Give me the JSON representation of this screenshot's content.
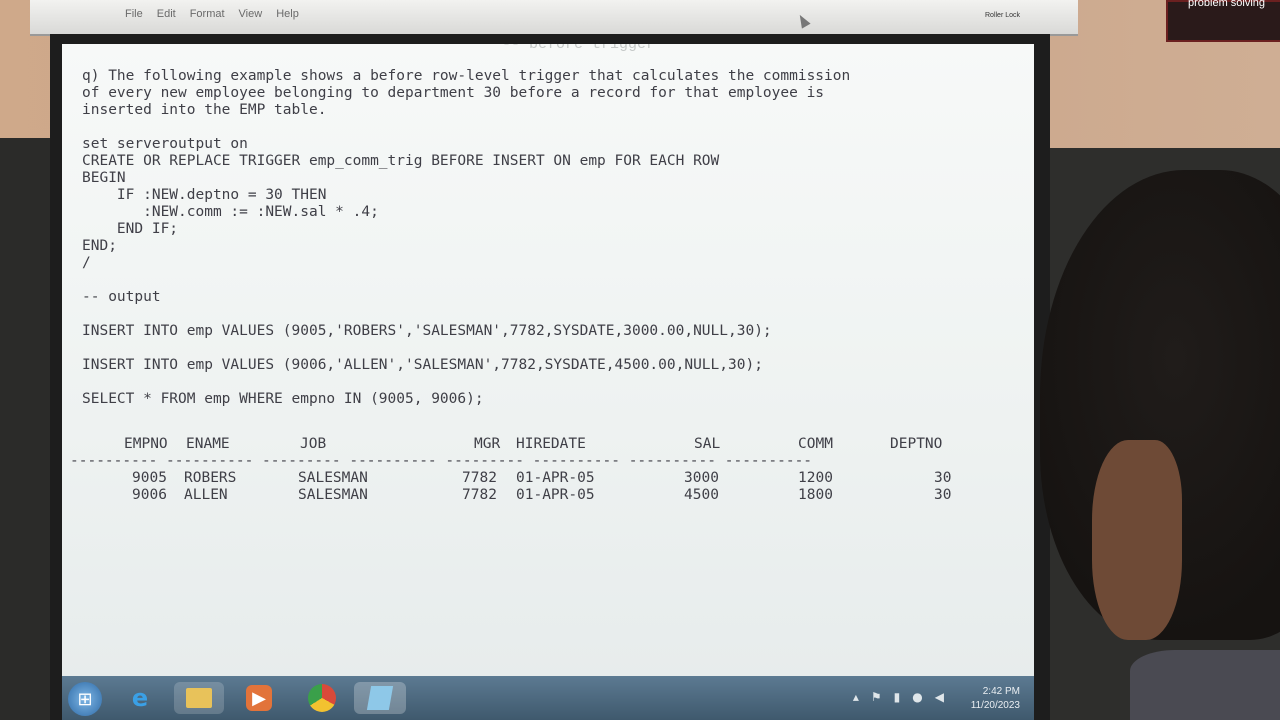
{
  "window": {
    "menu": [
      "File",
      "Edit",
      "Format",
      "View",
      "Help"
    ],
    "roller_tag": "Roller Lock"
  },
  "poster_text": "problem solving",
  "ghost_line": "-- before trigger",
  "editor_lines": [
    "q) The following example shows a before row-level trigger that calculates the commission",
    "of every new employee belonging to department 30 before a record for that employee is",
    "inserted into the EMP table.",
    "",
    "set serveroutput on",
    "CREATE OR REPLACE TRIGGER emp_comm_trig BEFORE INSERT ON emp FOR EACH ROW",
    "BEGIN",
    "    IF :NEW.deptno = 30 THEN",
    "       :NEW.comm := :NEW.sal * .4;",
    "    END IF;",
    "END;",
    "/",
    "",
    "-- output",
    "",
    "INSERT INTO emp VALUES (9005,'ROBERS','SALESMAN',7782,SYSDATE,3000.00,NULL,30);",
    "",
    "INSERT INTO emp VALUES (9006,'ALLEN','SALESMAN',7782,SYSDATE,4500.00,NULL,30);",
    "",
    "SELECT * FROM emp WHERE empno IN (9005, 9006);"
  ],
  "results": {
    "headers": [
      "EMPNO",
      "ENAME",
      "JOB",
      "MGR",
      "HIREDATE",
      "SAL",
      "COMM",
      "DEPTNO"
    ],
    "dashes": "---------- ---------- --------- ---------- --------- ---------- ---------- ----------",
    "rows": [
      [
        "9005",
        "ROBERS",
        "SALESMAN",
        "7782",
        "01-APR-05",
        "3000",
        "1200",
        "30"
      ],
      [
        "9006",
        "ALLEN",
        "SALESMAN",
        "7782",
        "01-APR-05",
        "4500",
        "1800",
        "30"
      ]
    ]
  },
  "taskbar": {
    "icons": [
      "start-orb-icon",
      "internet-explorer-icon",
      "file-explorer-icon",
      "media-player-icon",
      "chrome-icon",
      "notepad-icon"
    ],
    "time": "2:42 PM",
    "date": "11/20/2023"
  },
  "colors": {
    "screen_bg": "#f4f7f6",
    "text": "#3f3f47",
    "taskbar": "#4d687d"
  }
}
